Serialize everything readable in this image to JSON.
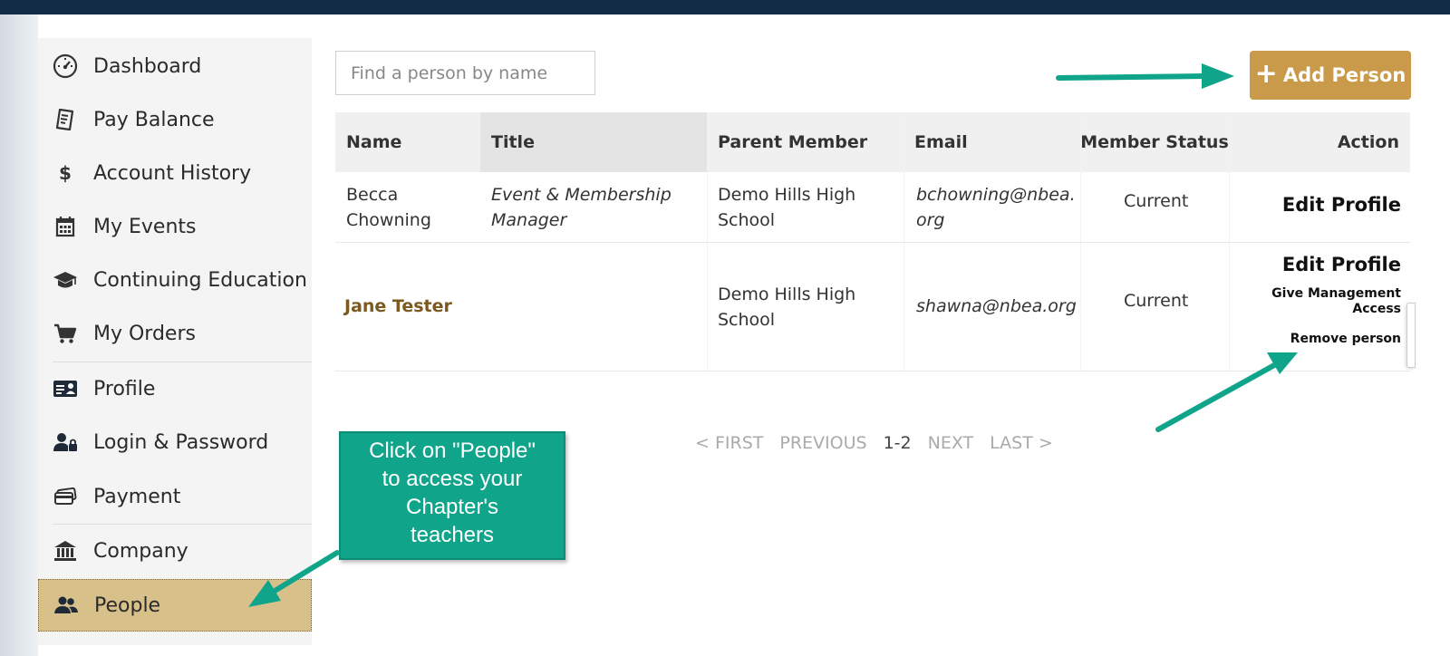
{
  "sidebar": {
    "items": [
      {
        "label": "Dashboard",
        "icon": "dashboard-icon"
      },
      {
        "label": "Pay Balance",
        "icon": "receipt-icon"
      },
      {
        "label": "Account History",
        "icon": "dollar-icon"
      },
      {
        "label": "My Events",
        "icon": "calendar-icon"
      },
      {
        "label": "Continuing Education",
        "icon": "graduation-cap-icon"
      },
      {
        "label": "My Orders",
        "icon": "cart-icon"
      },
      {
        "label": "Profile",
        "icon": "id-card-icon"
      },
      {
        "label": "Login & Password",
        "icon": "user-lock-icon"
      },
      {
        "label": "Payment",
        "icon": "credit-card-icon"
      },
      {
        "label": "Company",
        "icon": "bank-icon"
      },
      {
        "label": "People",
        "icon": "people-icon"
      }
    ],
    "active": "People"
  },
  "search": {
    "placeholder": "Find a person by name",
    "value": ""
  },
  "add_button": {
    "label": "Add Person"
  },
  "table": {
    "headers": [
      "Name",
      "Title",
      "Parent Member",
      "Email",
      "Member Status",
      "Action"
    ],
    "rows": [
      {
        "name": [
          "Becca",
          "Chowning"
        ],
        "title": [
          "Event & Membership",
          "Manager"
        ],
        "parent": [
          "Demo Hills High",
          "School"
        ],
        "email": [
          "bchowning@nbea.",
          "org"
        ],
        "status": "Current",
        "actions": [
          "Edit Profile"
        ]
      },
      {
        "name": [
          "Jane Tester"
        ],
        "title": [],
        "parent": [
          "Demo Hills High",
          "School"
        ],
        "email": [
          "shawna@nbea.org"
        ],
        "status": "Current",
        "actions": [
          "Edit Profile",
          "Give Management",
          "Access",
          "Remove person"
        ]
      }
    ]
  },
  "pager": {
    "first": "< FIRST",
    "previous": "PREVIOUS",
    "current": "1-2",
    "next": "NEXT",
    "last": "LAST >"
  },
  "callout": {
    "lines": [
      "Click on \"People\"",
      "to access your",
      "Chapter's",
      "teachers"
    ],
    "color": "#10a58a"
  },
  "colors": {
    "accent": "#c99a4a",
    "active_nav": "#d8c08a",
    "topbar": "#112a45",
    "arrow": "#10a58a"
  }
}
